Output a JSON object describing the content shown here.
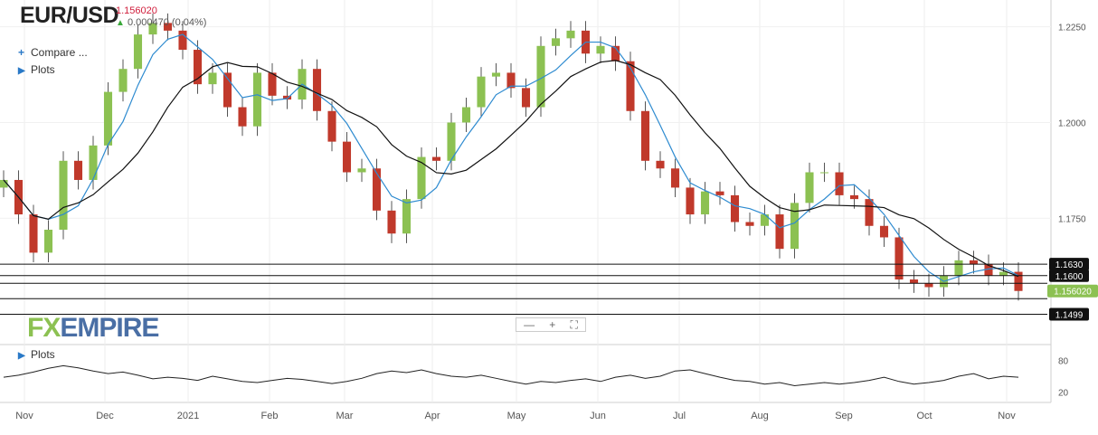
{
  "header": {
    "symbol": "EUR/USD",
    "price": "1.156020",
    "change": "0.000470 (0.04%)"
  },
  "menu": {
    "compare": "Compare ...",
    "plots_main": "Plots",
    "plots_sub": "Plots"
  },
  "logo": {
    "fx": "FX",
    "empire": "EMPIRE"
  },
  "colors": {
    "up": "#8cc152",
    "down": "#c0392b",
    "ma_fast": "#2e8bd0",
    "ma_slow": "#111111",
    "level_label_bg": "#111111",
    "current_label_bg": "#8cc152"
  },
  "chart_data": [
    {
      "type": "candlestick",
      "title": "EUR/USD",
      "x_tick_labels": [
        "Nov",
        "Dec",
        "2021",
        "Feb",
        "Mar",
        "Apr",
        "May",
        "Jun",
        "Jul",
        "Aug",
        "Sep",
        "Oct",
        "Nov"
      ],
      "y_tick_labels": [
        "1.2250",
        "1.2000",
        "1.1750"
      ],
      "ylim": [
        1.142,
        1.232
      ],
      "overlays": [
        "moving-average-fast (blue)",
        "moving-average-slow (black)"
      ],
      "horizontal_levels": [
        {
          "value": 1.163,
          "label": "1.1630"
        },
        {
          "value": 1.16,
          "label": "1.1600"
        },
        {
          "value": 1.158,
          "label": ""
        },
        {
          "value": 1.154,
          "label": ""
        },
        {
          "value": 1.1499,
          "label": "1.1499"
        }
      ],
      "current_price_label": "1.156020",
      "current_price": 1.156,
      "closes": [
        1.185,
        1.176,
        1.166,
        1.172,
        1.19,
        1.185,
        1.194,
        1.208,
        1.214,
        1.223,
        1.226,
        1.224,
        1.219,
        1.21,
        1.213,
        1.204,
        1.199,
        1.213,
        1.207,
        1.206,
        1.214,
        1.203,
        1.195,
        1.187,
        1.188,
        1.177,
        1.171,
        1.18,
        1.191,
        1.19,
        1.2,
        1.204,
        1.212,
        1.213,
        1.209,
        1.204,
        1.22,
        1.222,
        1.224,
        1.218,
        1.22,
        1.216,
        1.203,
        1.19,
        1.188,
        1.183,
        1.176,
        1.182,
        1.181,
        1.174,
        1.173,
        1.176,
        1.167,
        1.179,
        1.187,
        1.187,
        1.181,
        1.18,
        1.173,
        1.17,
        1.159,
        1.158,
        1.157,
        1.16,
        1.164,
        1.163,
        1.16,
        1.161,
        1.156
      ]
    },
    {
      "type": "line",
      "title": "Plots",
      "y_tick_labels": [
        "80",
        "20"
      ],
      "ylim": [
        0,
        100
      ],
      "x_tick_labels": [
        "Nov",
        "Dec",
        "2021",
        "Feb",
        "Mar",
        "Apr",
        "May",
        "Jun",
        "Jul",
        "Aug",
        "Sep",
        "Oct",
        "Nov"
      ],
      "values": [
        48,
        52,
        58,
        65,
        70,
        66,
        60,
        55,
        58,
        52,
        45,
        48,
        46,
        42,
        50,
        45,
        40,
        38,
        42,
        46,
        44,
        40,
        36,
        40,
        46,
        55,
        60,
        57,
        62,
        55,
        50,
        48,
        52,
        46,
        40,
        35,
        40,
        38,
        42,
        45,
        40,
        48,
        52,
        46,
        50,
        60,
        62,
        55,
        48,
        42,
        40,
        35,
        38,
        32,
        35,
        38,
        35,
        38,
        42,
        48,
        40,
        35,
        38,
        42,
        50,
        55,
        45,
        50,
        48
      ]
    }
  ]
}
